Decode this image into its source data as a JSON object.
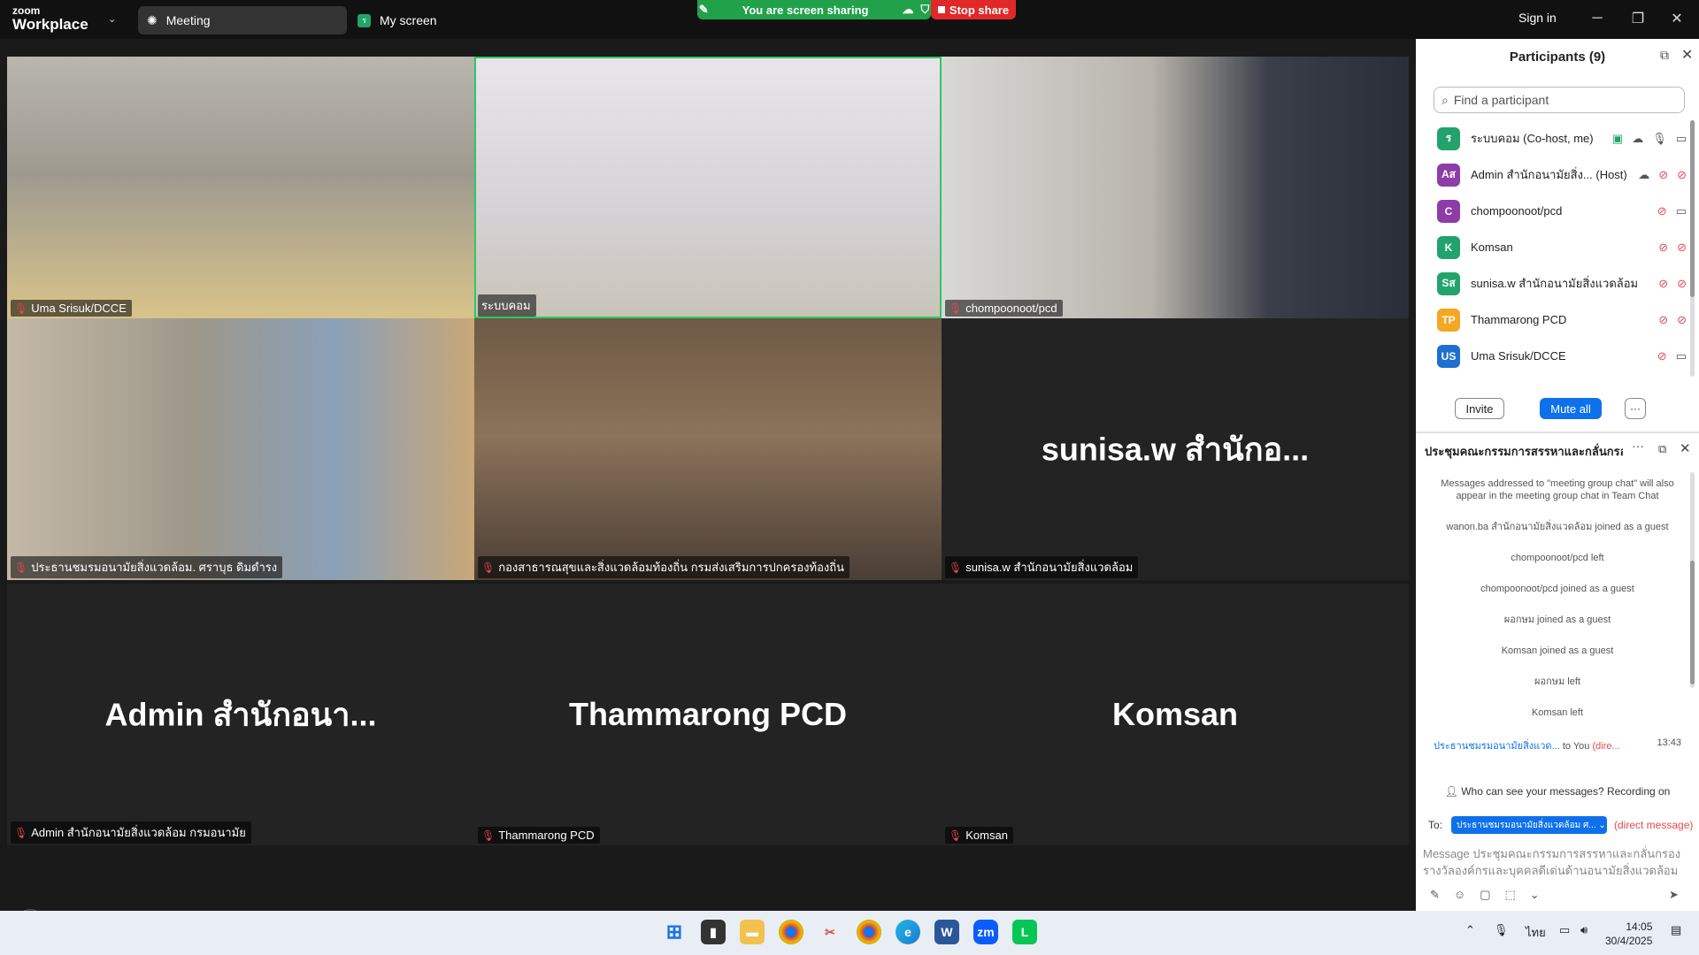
{
  "app": {
    "logo_line1": "zoom",
    "logo_line2": "Workplace",
    "tab_meeting": "Meeting",
    "tab_my_screen": "My screen",
    "my_screen_badge": "ร",
    "sharing_banner": "You are screen sharing",
    "stop_share": "Stop share",
    "sign_in": "Sign in"
  },
  "tiles": [
    {
      "name": "Uma Srisuk/DCCE",
      "type": "video"
    },
    {
      "name": "ระบบคอม",
      "type": "video",
      "active": true
    },
    {
      "name": "chompoonoot/pcd",
      "type": "video"
    },
    {
      "name": "ประธานชมรมอนามัยสิ่งแวดล้อม. ศราบุธ ดิมดำรง",
      "type": "video"
    },
    {
      "name": "กองสาธารณสุขและสิ่งแวดล้อมท้องถิ่น กรมส่งเสริมการปกครองท้องถิ่น",
      "type": "video"
    },
    {
      "name": "sunisa.w สำนักอนามัยสิ่งแวดล้อม",
      "type": "avatar",
      "display": "sunisa.w สำนักอ..."
    },
    {
      "name": "Admin สำนักอนามัยสิ่งแวดล้อม กรมอนามัย",
      "type": "avatar",
      "display": "Admin สำนักอนา..."
    },
    {
      "name": "Thammarong PCD",
      "type": "avatar",
      "display": "Thammarong PCD"
    },
    {
      "name": "Komsan",
      "type": "avatar",
      "display": "Komsan"
    }
  ],
  "participants": {
    "title": "Participants (9)",
    "search_placeholder": "Find a participant",
    "list": [
      {
        "initials": "ร",
        "name": "ระบบคอม (Co-host, me)",
        "color": "#22a36b"
      },
      {
        "initials": "Aส",
        "name": "Admin สำนักอนามัยสิ่ง...  (Host)",
        "color": "#8e3ca8"
      },
      {
        "initials": "C",
        "name": "chompoonoot/pcd",
        "color": "#8e3ca8"
      },
      {
        "initials": "K",
        "name": "Komsan",
        "color": "#22a36b"
      },
      {
        "initials": "Sส",
        "name": "sunisa.w สำนักอนามัยสิ่งแวดล้อม",
        "color": "#22a36b"
      },
      {
        "initials": "TP",
        "name": "Thammarong PCD",
        "color": "#f5a623"
      },
      {
        "initials": "US",
        "name": "Uma Srisuk/DCCE",
        "color": "#1f6fd1"
      }
    ],
    "invite": "Invite",
    "mute_all": "Mute all",
    "more": "···"
  },
  "chat": {
    "title": "ประชุมคณะกรรมการสรรหาและกลั่นกรอง",
    "messages": [
      "Messages addressed to \"meeting group chat\" will also appear in the meeting group chat in Team Chat",
      "wanon.ba สำนักอนามัยสิ่งแวดล้อม joined as a guest",
      "chompoonoot/pcd left",
      "chompoonoot/pcd joined as a guest",
      "ผอกษม joined as a guest",
      "Komsan joined as a guest",
      "ผอกษม left",
      "Komsan left"
    ],
    "dm_from": "ประธานชมรมอนามัยสิ่งแวด...",
    "dm_to": "to You",
    "dm_tag": "(dire...",
    "dm_time": "13:43",
    "who_can_see": "Who can see your messages? Recording on",
    "to_label": "To:",
    "to_value": "ประธานชมรมอนามัยสิ่งแวดล้อม ศ...",
    "direct_tag": "(direct message)",
    "input_placeholder": "Message ประชุมคณะกรรมการสรรหาและกลั่นกรองรางวัลองค์กรและบุคคลดีเด่นด้านอนามัยสิ่งแวดล้อม"
  },
  "taskbar": {
    "lang": "ไทย",
    "time": "14:05",
    "date": "30/4/2025"
  }
}
